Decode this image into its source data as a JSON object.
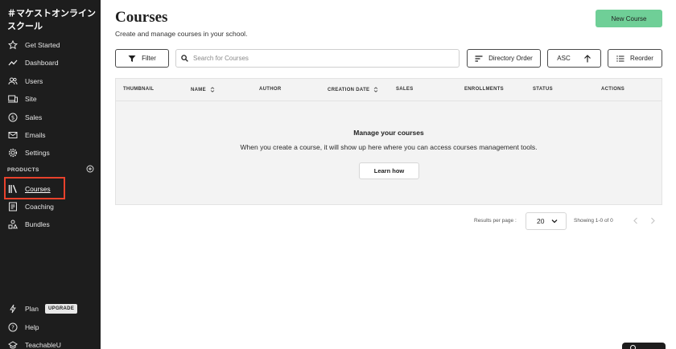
{
  "sidebar": {
    "school_name": "＃マケストオンラインスクール",
    "nav": [
      {
        "label": "Get Started",
        "icon": "star-icon"
      },
      {
        "label": "Dashboard",
        "icon": "trend-line-icon"
      },
      {
        "label": "Users",
        "icon": "users-icon"
      },
      {
        "label": "Site",
        "icon": "devices-icon"
      },
      {
        "label": "Sales",
        "icon": "dollar-icon"
      },
      {
        "label": "Emails",
        "icon": "mail-icon"
      },
      {
        "label": "Settings",
        "icon": "gear-icon"
      }
    ],
    "products_label": "PRODUCTS",
    "products": [
      {
        "label": "Courses",
        "icon": "library-icon",
        "active": true
      },
      {
        "label": "Coaching",
        "icon": "notebook-icon"
      },
      {
        "label": "Bundles",
        "icon": "bundle-icon"
      }
    ],
    "footer": [
      {
        "label": "Plan",
        "icon": "bolt-icon",
        "badge": "UPGRADE"
      },
      {
        "label": "Help",
        "icon": "help-icon"
      },
      {
        "label": "TeachableU",
        "icon": "graduation-cap-icon"
      }
    ]
  },
  "header": {
    "title": "Courses",
    "subtitle": "Create and manage courses in your school.",
    "new_course": "New Course"
  },
  "toolbar": {
    "filter": "Filter",
    "search_placeholder": "Search for Courses",
    "sort_by": "Directory Order",
    "order": "ASC",
    "reorder": "Reorder"
  },
  "table": {
    "columns": [
      "THUMBNAIL",
      "NAME",
      "AUTHOR",
      "CREATION DATE",
      "SALES",
      "ENROLLMENTS",
      "STATUS",
      "ACTIONS"
    ],
    "empty_title": "Manage your courses",
    "empty_text": "When you create a course, it will show up here where you can access courses management tools.",
    "learn_how": "Learn how"
  },
  "pagination": {
    "results_per_page_label": "Results per page :",
    "results_per_page": "20",
    "showing": "Showing 1-0 of 0"
  },
  "colors": {
    "sidebar_bg": "#1d1d1d",
    "accent": "#6fcf97",
    "highlight": "#e8422c"
  }
}
